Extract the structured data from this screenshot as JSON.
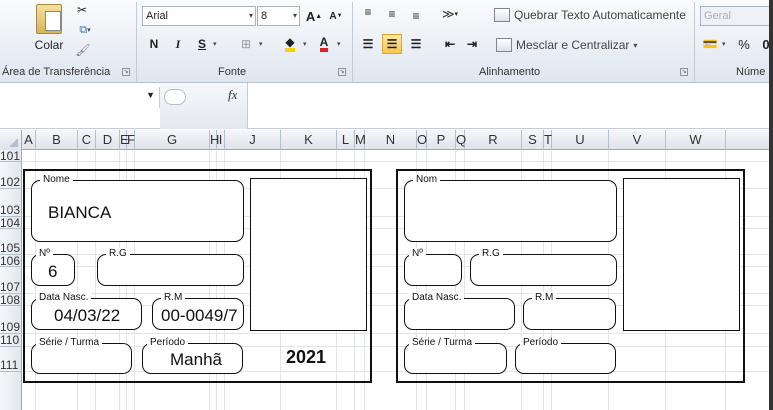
{
  "ribbon": {
    "clipboard": {
      "paste_label": "Colar",
      "group_label": "Área de Transferência"
    },
    "font": {
      "family": "Arial",
      "size": "8",
      "group_label": "Fonte",
      "bold": "N",
      "italic": "I",
      "underline": "S",
      "grow": "A",
      "shrink": "A"
    },
    "alignment": {
      "wrap_text": "Quebrar Texto Automaticamente",
      "merge_center": "Mesclar e Centralizar",
      "group_label": "Alinhamento"
    },
    "number": {
      "format": "Geral",
      "percent": "%",
      "comma": "0",
      "group_label": "Núme"
    }
  },
  "formula_bar": {
    "fx": "fx",
    "value": ""
  },
  "columns": [
    "A",
    "B",
    "C",
    "D",
    "E",
    "F",
    "G",
    "H",
    "I",
    "J",
    "K",
    "L",
    "M",
    "N",
    "O",
    "P",
    "Q",
    "R",
    "S",
    "T",
    "U",
    "V",
    "W"
  ],
  "rows": [
    "101",
    "102",
    "103",
    "104",
    "105",
    "106",
    "107",
    "108",
    "109",
    "110",
    "111"
  ],
  "cards": [
    {
      "name_label": "Nome",
      "name_value": "BIANCA",
      "number_label": "Nº",
      "number_value": "6",
      "rg_label": "R.G",
      "rg_value": "",
      "birth_label": "Data Nasc.",
      "birth_value": "04/03/22",
      "rm_label": "R.M",
      "rm_value": "00-0049/7",
      "class_label": "Série / Turma",
      "class_value": "",
      "period_label": "Período",
      "period_value": "Manhã",
      "year": "2021"
    },
    {
      "name_label": "Nom",
      "name_value": "",
      "number_label": "Nº",
      "number_value": "",
      "rg_label": "R.G",
      "rg_value": "",
      "birth_label": "Data Nasc.",
      "birth_value": "",
      "rm_label": "R.M",
      "rm_value": "",
      "class_label": "Série / Turma",
      "class_value": "",
      "period_label": "Período",
      "period_value": "",
      "year": ""
    }
  ]
}
